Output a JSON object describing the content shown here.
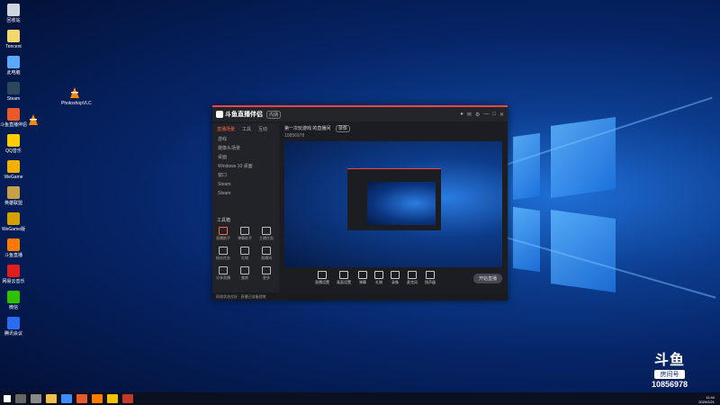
{
  "desktop": {
    "icons": [
      {
        "label": "回收站",
        "color": "#d0d6e0"
      },
      {
        "label": "Tencent",
        "color": "#f5d76e"
      },
      {
        "label": "此电脑",
        "color": "#5aa9ff"
      },
      {
        "label": "Steam",
        "color": "#2a475e"
      },
      {
        "label": "斗鱼直播伴侣",
        "color": "#e85a2a"
      },
      {
        "label": "QQ音乐",
        "color": "#ffcc00"
      },
      {
        "label": "WeGame",
        "color": "#f0b000"
      },
      {
        "label": "英雄联盟",
        "color": "#c8a04a"
      },
      {
        "label": "WeGame版",
        "color": "#d4a000"
      },
      {
        "label": "斗鱼直播",
        "color": "#ff7a00"
      },
      {
        "label": "网易云音乐",
        "color": "#e01e1e"
      },
      {
        "label": "微信",
        "color": "#2dc100"
      },
      {
        "label": "腾讯会议",
        "color": "#2a6cf0"
      }
    ],
    "vlc_icon_label": "PhotoshopVLC"
  },
  "app": {
    "title": "斗鱼直播伴侣",
    "version_badge": "内测",
    "room_title": "第一次玩游戏 的直播间",
    "room_badge": "录像",
    "room_id": "10856978",
    "tabs": [
      "直播场景",
      "工具",
      "互动"
    ],
    "scenes": [
      "游戏",
      "摄像头场景",
      "桌面",
      "Windows 10 桌面",
      "窗口",
      "Steam",
      "Steam"
    ],
    "tools_heading": "工具箱",
    "tools": [
      "直播助手",
      "弹幕助手",
      "主播任务",
      "粉丝任务",
      "礼物",
      "直播间",
      "分享直播",
      "美颜",
      "更多"
    ],
    "bottom_controls": [
      "直播设置",
      "画面设置",
      "弹幕",
      "礼物",
      "录像",
      "麦克风",
      "扬声器"
    ],
    "go_live_label": "开始直播",
    "status_text": "网络状态良好 · 直播已准备就绪"
  },
  "watermark": {
    "brand": "斗鱼",
    "room_label": "房间号",
    "room_number": "10856978"
  },
  "clock": {
    "time": "11:44",
    "date": "2020/2/21"
  }
}
